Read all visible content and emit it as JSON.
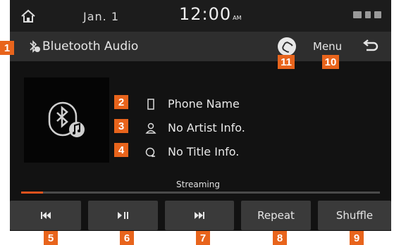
{
  "status_bar": {
    "date": "Jan.  1",
    "time": "12:00",
    "ampm": "AM",
    "home_icon": "home-icon"
  },
  "title_bar": {
    "title": "Bluetooth Audio",
    "menu_label": "Menu",
    "circle_icon": "mode-icon",
    "back_icon": "back-icon"
  },
  "track": {
    "phone_name": "Phone Name",
    "artist": "No Artist Info.",
    "title": "No Title Info.",
    "status": "Streaming",
    "progress": 0.06
  },
  "controls": [
    {
      "name": "previous-button",
      "icon": "previous-icon"
    },
    {
      "name": "play-pause-button",
      "icon": "play-pause-icon"
    },
    {
      "name": "next-button",
      "icon": "next-icon"
    },
    {
      "name": "repeat-button",
      "label": "Repeat"
    },
    {
      "name": "shuffle-button",
      "label": "Shuffle"
    }
  ],
  "callouts": [
    "1",
    "2",
    "3",
    "4",
    "5",
    "6",
    "7",
    "8",
    "9",
    "10",
    "11"
  ],
  "colors": {
    "callout": "#e8641c",
    "progress": "#e0521d",
    "background": "#121212",
    "bar": "#2e2e2e",
    "button": "#3a3a3a"
  }
}
